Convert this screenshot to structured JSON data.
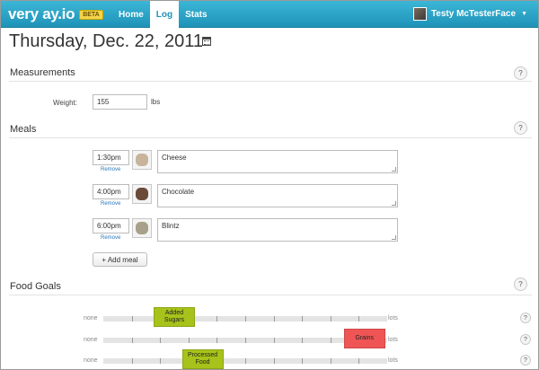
{
  "navbar": {
    "brand": "very ay.io",
    "beta": "BETA",
    "items": [
      {
        "label": "Home",
        "active": false
      },
      {
        "label": "Log",
        "active": true
      },
      {
        "label": "Stats",
        "active": false
      }
    ],
    "user": "Testy McTesterFace",
    "caret_icon": "caret-down-icon"
  },
  "page": {
    "title": "Thursday, Dec. 22, 2011",
    "calendar_icon": "calendar-icon"
  },
  "measurements": {
    "title": "Measurements",
    "help": "?",
    "weight_label": "Weight:",
    "weight_value": "155",
    "weight_unit": "lbs"
  },
  "meals": {
    "title": "Meals",
    "help": "?",
    "items": [
      {
        "time": "1:30pm",
        "remove": "Remove",
        "text": "Cheese",
        "thumb_color": "#c8b49a"
      },
      {
        "time": "4:00pm",
        "remove": "Remove",
        "text": "Chocolate",
        "thumb_color": "#6b4a3a"
      },
      {
        "time": "6:00pm",
        "remove": "Remove",
        "text": "Blintz",
        "thumb_color": "#a8a08a"
      }
    ],
    "add_label": "+ Add meal"
  },
  "food_goals": {
    "title": "Food Goals",
    "help": "?",
    "none_label": "none",
    "lots_label": "lots",
    "goals": [
      {
        "label": "Added Sugars",
        "level": 0.25,
        "color": "#a7c21a"
      },
      {
        "label": "Grains",
        "level": 0.92,
        "color": "#f05555"
      },
      {
        "label": "Processed Food",
        "level": 0.35,
        "color": "#a7c21a"
      }
    ]
  },
  "colors": {
    "navbar": "#2aa3c8",
    "link": "#2a78b8"
  }
}
